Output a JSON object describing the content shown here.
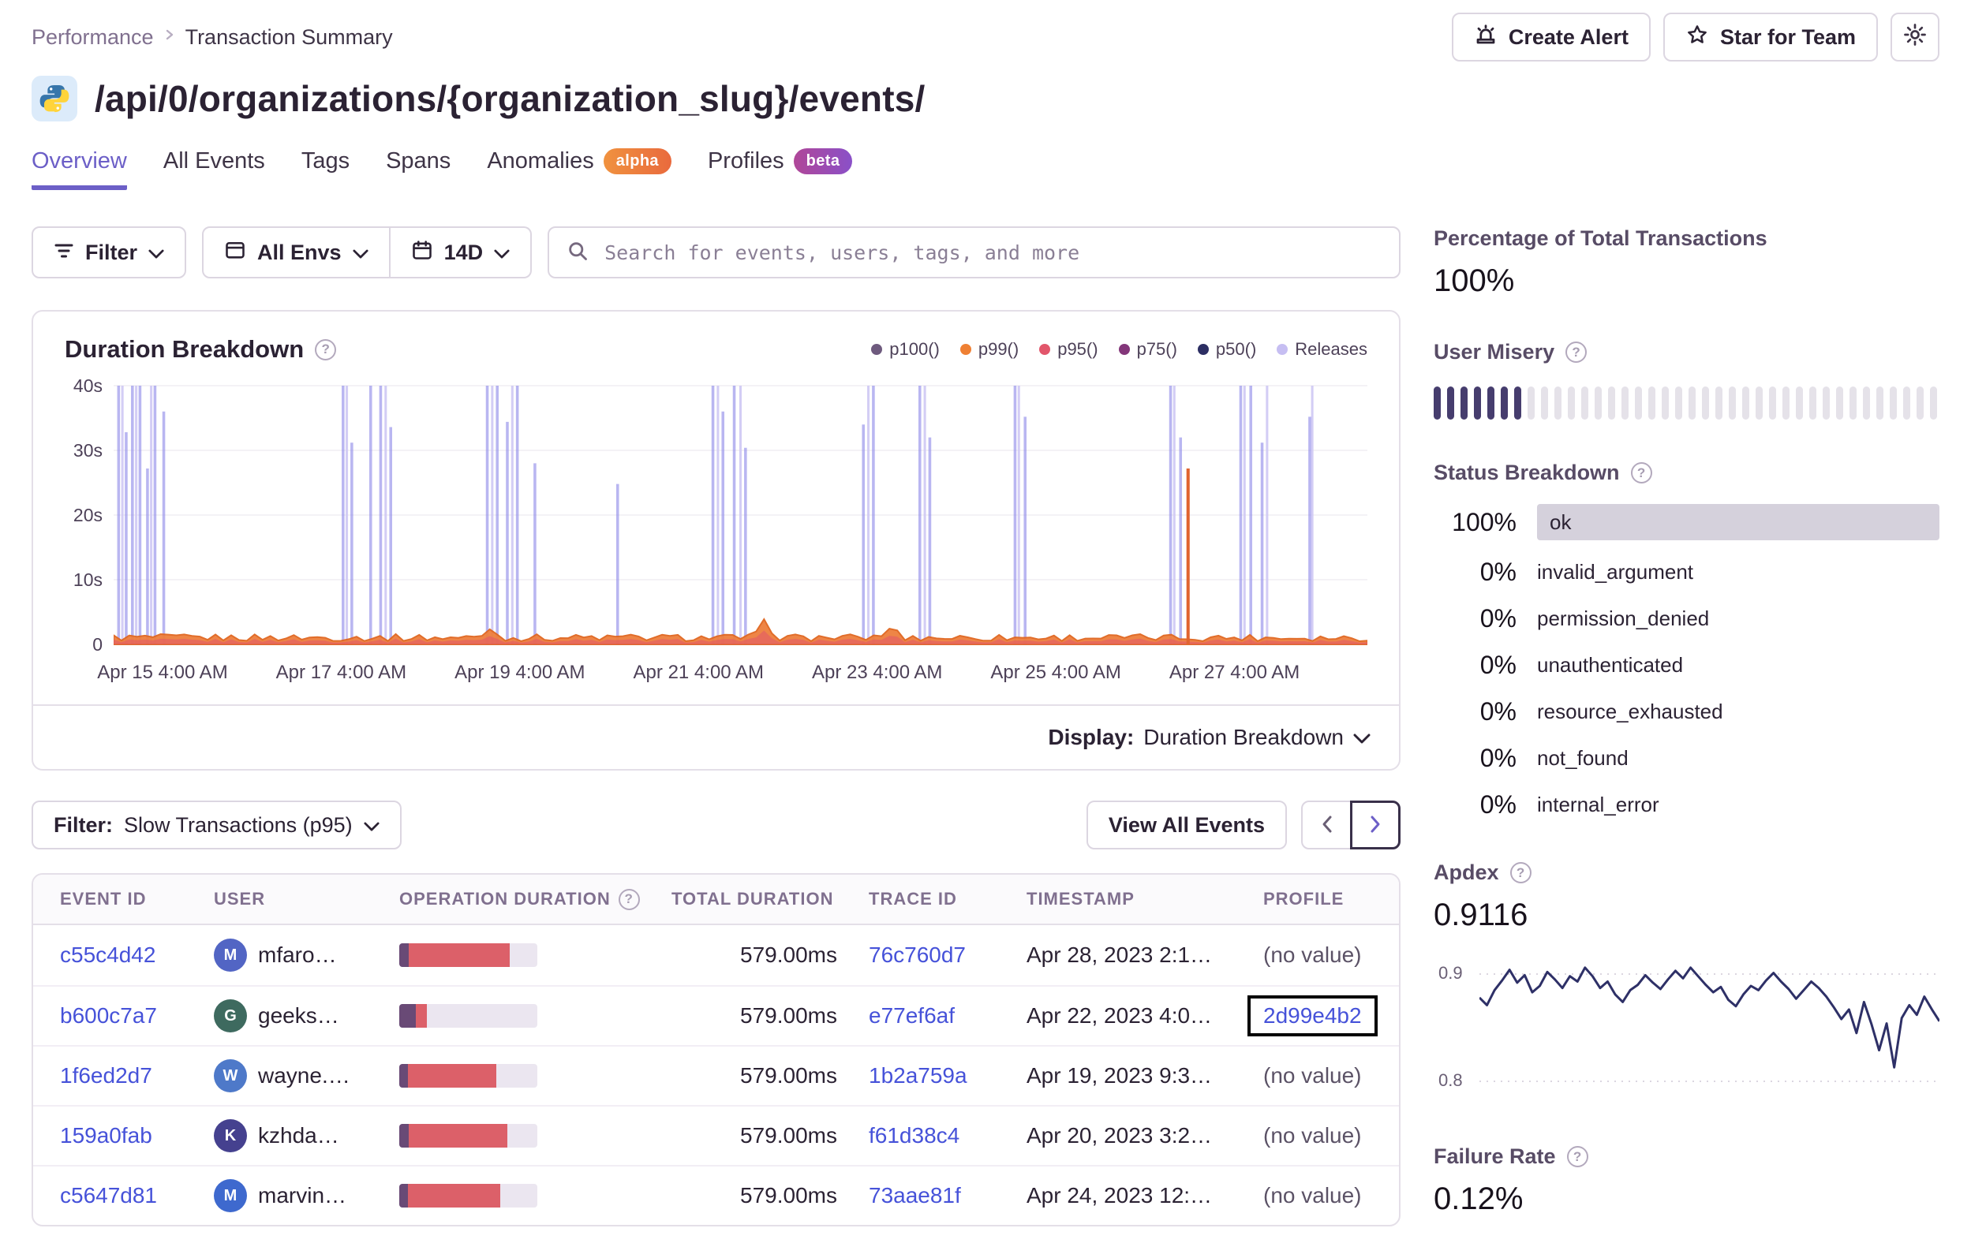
{
  "breadcrumb": {
    "parent": "Performance",
    "current": "Transaction Summary"
  },
  "header_actions": {
    "create_alert": "Create Alert",
    "star": "Star for Team"
  },
  "title": "/api/0/organizations/{organization_slug}/events/",
  "tabs": {
    "items": [
      {
        "label": "Overview",
        "active": true
      },
      {
        "label": "All Events"
      },
      {
        "label": "Tags"
      },
      {
        "label": "Spans"
      },
      {
        "label": "Anomalies",
        "badge": "alpha"
      },
      {
        "label": "Profiles",
        "badge": "beta"
      }
    ]
  },
  "filters": {
    "filter_label": "Filter",
    "env_label": "All Envs",
    "date_label": "14D",
    "search_placeholder": "Search for events, users, tags, and more"
  },
  "chart": {
    "title": "Duration Breakdown",
    "legend": [
      {
        "label": "p100()",
        "color": "#6E5A7E"
      },
      {
        "label": "p99()",
        "color": "#EF8033"
      },
      {
        "label": "p95()",
        "color": "#E2566B"
      },
      {
        "label": "p75()",
        "color": "#83367A"
      },
      {
        "label": "p50()",
        "color": "#2C2E63"
      },
      {
        "label": "Releases",
        "color": "#C6BEF2"
      }
    ],
    "y_ticks": [
      "40s",
      "30s",
      "20s",
      "10s",
      "0"
    ],
    "x_ticks": [
      "Apr 15 4:00 AM",
      "Apr 17 4:00 AM",
      "Apr 19 4:00 AM",
      "Apr 21 4:00 AM",
      "Apr 23 4:00 AM",
      "Apr 25 4:00 AM",
      "Apr 27 4:00 AM"
    ],
    "display_label": "Display:",
    "display_value": "Duration Breakdown",
    "spikes": [
      {
        "x": 0.004,
        "h": 1
      },
      {
        "x": 0.01,
        "h": 0.82
      },
      {
        "x": 0.015,
        "h": 1
      },
      {
        "x": 0.021,
        "h": 1
      },
      {
        "x": 0.027,
        "h": 0.68
      },
      {
        "x": 0.033,
        "h": 1
      },
      {
        "x": 0.04,
        "h": 0.9
      },
      {
        "x": 0.183,
        "h": 1
      },
      {
        "x": 0.19,
        "h": 0.78
      },
      {
        "x": 0.205,
        "h": 1
      },
      {
        "x": 0.213,
        "h": 1
      },
      {
        "x": 0.221,
        "h": 0.84
      },
      {
        "x": 0.298,
        "h": 1
      },
      {
        "x": 0.306,
        "h": 1
      },
      {
        "x": 0.314,
        "h": 0.86
      },
      {
        "x": 0.322,
        "h": 1
      },
      {
        "x": 0.336,
        "h": 0.7
      },
      {
        "x": 0.402,
        "h": 0.62
      },
      {
        "x": 0.478,
        "h": 1
      },
      {
        "x": 0.486,
        "h": 0.9
      },
      {
        "x": 0.495,
        "h": 1
      },
      {
        "x": 0.504,
        "h": 0.76
      },
      {
        "x": 0.598,
        "h": 0.85
      },
      {
        "x": 0.606,
        "h": 1
      },
      {
        "x": 0.643,
        "h": 1
      },
      {
        "x": 0.651,
        "h": 0.8
      },
      {
        "x": 0.719,
        "h": 1
      },
      {
        "x": 0.727,
        "h": 0.88
      },
      {
        "x": 0.843,
        "h": 1
      },
      {
        "x": 0.851,
        "h": 0.8
      },
      {
        "x": 0.899,
        "h": 1
      },
      {
        "x": 0.907,
        "h": 1
      },
      {
        "x": 0.916,
        "h": 0.78
      },
      {
        "x": 0.954,
        "h": 0.88
      }
    ],
    "releases_x": [
      0.007,
      0.018,
      0.03,
      0.186,
      0.217,
      0.302,
      0.318,
      0.482,
      0.5,
      0.602,
      0.647,
      0.722,
      0.846,
      0.902,
      0.92,
      0.956
    ],
    "bumps": [
      {
        "x": 0.3,
        "h": 0.04,
        "w": 0.005
      },
      {
        "x": 0.52,
        "h": 0.06,
        "w": 0.006
      },
      {
        "x": 0.62,
        "h": 0.045,
        "w": 0.005
      }
    ],
    "orange_spike": {
      "x": 0.857,
      "h": 0.68
    }
  },
  "table_toolbar": {
    "filter_label": "Filter:",
    "filter_value": "Slow Transactions (p95)",
    "view_all": "View All Events"
  },
  "table": {
    "columns": [
      "EVENT ID",
      "USER",
      "OPERATION DURATION",
      "TOTAL DURATION",
      "TRACE ID",
      "TIMESTAMP",
      "PROFILE"
    ],
    "rows": [
      {
        "event_id": "c55c4d42",
        "initial": "M",
        "user": "mfaro…",
        "avatar": "#5265C4",
        "op": [
          7,
          73
        ],
        "total": "579.00ms",
        "trace": "76c760d7",
        "time": "Apr 28, 2023 2:1…",
        "profile": "(no value)"
      },
      {
        "event_id": "b600c7a7",
        "initial": "G",
        "user": "geeks…",
        "avatar": "#3E6A5F",
        "op": [
          12,
          8
        ],
        "total": "579.00ms",
        "trace": "e77ef6af",
        "time": "Apr 22, 2023 4:0…",
        "profile": "2d99e4b2",
        "profile_link": true,
        "highlight": true
      },
      {
        "event_id": "1f6ed2d7",
        "initial": "W",
        "user": "wayne.…",
        "avatar": "#4E79C9",
        "op": [
          6,
          64
        ],
        "total": "579.00ms",
        "trace": "1b2a759a",
        "time": "Apr 19, 2023 9:3…",
        "profile": "(no value)"
      },
      {
        "event_id": "159a0fab",
        "initial": "K",
        "user": "kzhda…",
        "avatar": "#45418F",
        "op": [
          7,
          71
        ],
        "total": "579.00ms",
        "trace": "f61d38c4",
        "time": "Apr 20, 2023 3:2…",
        "profile": "(no value)"
      },
      {
        "event_id": "c5647d81",
        "initial": "M",
        "user": "marvin…",
        "avatar": "#3E69CE",
        "op": [
          6,
          67
        ],
        "total": "579.00ms",
        "trace": "73aae81f",
        "time": "Apr 24, 2023 12:…",
        "profile": "(no value)"
      }
    ]
  },
  "sidebar": {
    "pct_total": {
      "heading": "Percentage of Total Transactions",
      "value": "100%"
    },
    "user_misery": {
      "heading": "User Misery",
      "ticks_total": 38,
      "ticks_filled": 7
    },
    "status_breakdown": {
      "heading": "Status Breakdown",
      "rows": [
        {
          "pct": "100%",
          "label": "ok",
          "bar": true
        },
        {
          "pct": "0%",
          "label": "invalid_argument"
        },
        {
          "pct": "0%",
          "label": "permission_denied"
        },
        {
          "pct": "0%",
          "label": "unauthenticated"
        },
        {
          "pct": "0%",
          "label": "resource_exhausted"
        },
        {
          "pct": "0%",
          "label": "not_found"
        },
        {
          "pct": "0%",
          "label": "internal_error"
        }
      ]
    },
    "apdex": {
      "heading": "Apdex",
      "value": "0.9116",
      "y_top": "0.9",
      "y_bottom": "0.8",
      "points": [
        0.878,
        0.871,
        0.885,
        0.894,
        0.904,
        0.892,
        0.899,
        0.883,
        0.889,
        0.902,
        0.895,
        0.887,
        0.898,
        0.893,
        0.906,
        0.898,
        0.887,
        0.893,
        0.881,
        0.874,
        0.885,
        0.89,
        0.899,
        0.892,
        0.886,
        0.895,
        0.903,
        0.896,
        0.906,
        0.898,
        0.89,
        0.883,
        0.888,
        0.876,
        0.87,
        0.881,
        0.889,
        0.885,
        0.894,
        0.901,
        0.893,
        0.886,
        0.877,
        0.885,
        0.893,
        0.887,
        0.879,
        0.869,
        0.858,
        0.867,
        0.845,
        0.874,
        0.853,
        0.829,
        0.854,
        0.813,
        0.859,
        0.871,
        0.862,
        0.879,
        0.867,
        0.856
      ]
    },
    "failure_rate": {
      "heading": "Failure Rate",
      "value": "0.12%"
    }
  }
}
